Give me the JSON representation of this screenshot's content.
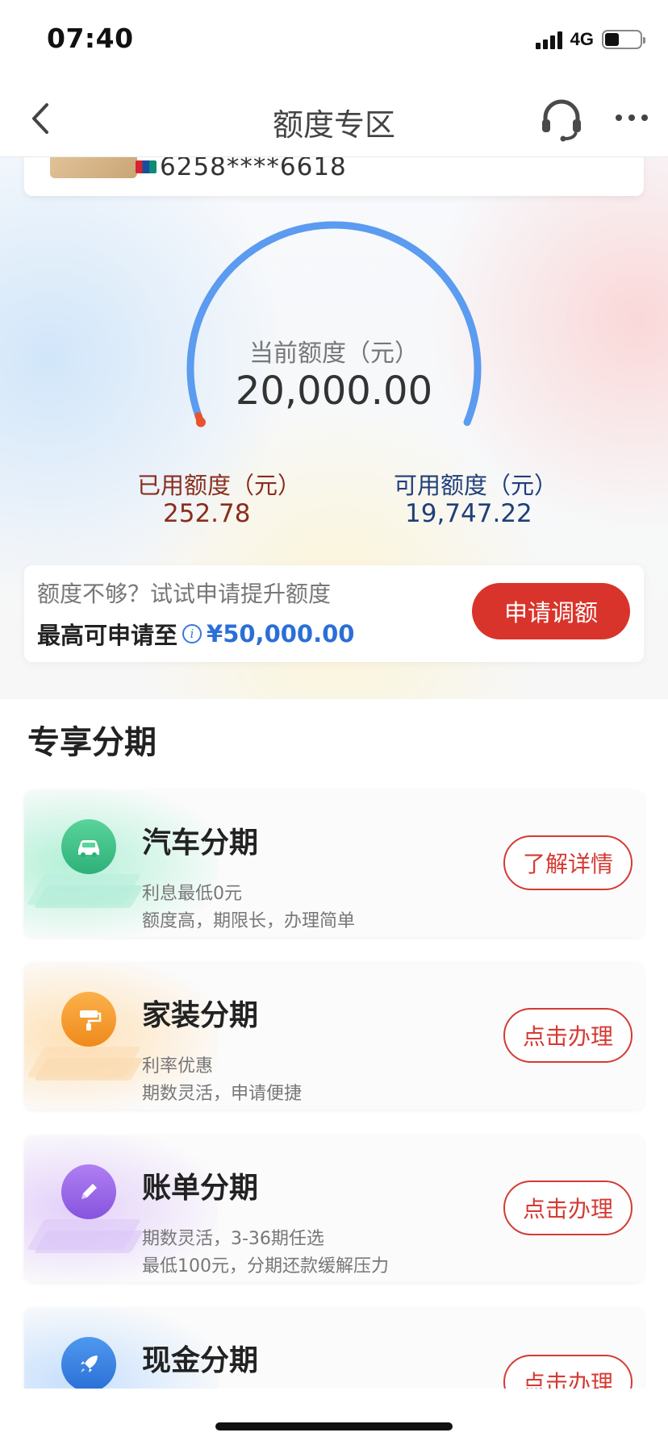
{
  "status_bar": {
    "time": "07:40",
    "network": "4G",
    "battery_level": 0.4
  },
  "nav": {
    "title": "额度专区",
    "back_icon": "chevron-left-icon",
    "service_icon": "headset-icon",
    "more_icon": "more-dots-icon"
  },
  "card": {
    "number": "6258****6618"
  },
  "gauge": {
    "label": "当前额度（元）",
    "value": "20,000.00",
    "used_label": "已用额度（元）",
    "used_value": "252.78",
    "available_label": "可用额度（元）",
    "available_value": "19,747.22",
    "used_fraction": 0.0126,
    "arc_color": "#5b9bf0",
    "used_color": "#e8532d"
  },
  "raise": {
    "tip": "额度不够？试试申请提升额度",
    "max_label": "最高可申请至",
    "max_amount": "¥50,000.00",
    "button": "申请调额"
  },
  "section": {
    "title": "专享分期"
  },
  "installments": [
    {
      "title": "汽车分期",
      "desc1": "利息最低0元",
      "desc2": "额度高，期限长，办理简单",
      "button": "了解详情",
      "icon": "car-icon",
      "color": "#3fbf86"
    },
    {
      "title": "家装分期",
      "desc1": "利率优惠",
      "desc2": "期数灵活，申请便捷",
      "button": "点击办理",
      "icon": "paint-roller-icon",
      "color": "#f39a2a"
    },
    {
      "title": "账单分期",
      "desc1": "期数灵活，3-36期任选",
      "desc2": "最低100元，分期还款缓解压力",
      "button": "点击办理",
      "icon": "pen-icon",
      "color": "#9a6be6"
    },
    {
      "title": "现金分期",
      "desc1": "",
      "desc2": "",
      "button": "点击办理",
      "icon": "rocket-icon",
      "color": "#3a82e0"
    }
  ]
}
